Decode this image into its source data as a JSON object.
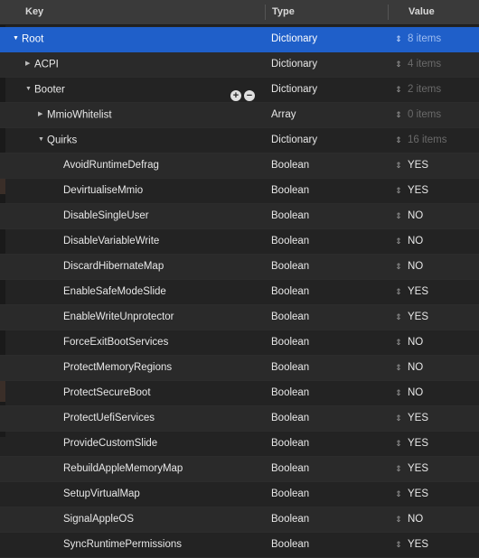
{
  "header": {
    "key": "Key",
    "type": "Type",
    "value": "Value"
  },
  "rows": [
    {
      "key": "Root",
      "type": "Dictionary",
      "value": "8 items",
      "disclosure": "open",
      "indent": 0,
      "value_dim": true
    },
    {
      "key": "ACPI",
      "type": "Dictionary",
      "value": "4 items",
      "disclosure": "closed",
      "indent": 1,
      "value_dim": true
    },
    {
      "key": "Booter",
      "type": "Dictionary",
      "value": "2 items",
      "disclosure": "open",
      "indent": 1,
      "value_dim": true,
      "has_add_remove": true
    },
    {
      "key": "MmioWhitelist",
      "type": "Array",
      "value": "0 items",
      "disclosure": "closed",
      "indent": 2,
      "value_dim": true
    },
    {
      "key": "Quirks",
      "type": "Dictionary",
      "value": "16 items",
      "disclosure": "open",
      "indent": 2,
      "value_dim": true
    },
    {
      "key": "AvoidRuntimeDefrag",
      "type": "Boolean",
      "value": "YES",
      "indent": 3
    },
    {
      "key": "DevirtualiseMmio",
      "type": "Boolean",
      "value": "YES",
      "indent": 3
    },
    {
      "key": "DisableSingleUser",
      "type": "Boolean",
      "value": "NO",
      "indent": 3
    },
    {
      "key": "DisableVariableWrite",
      "type": "Boolean",
      "value": "NO",
      "indent": 3
    },
    {
      "key": "DiscardHibernateMap",
      "type": "Boolean",
      "value": "NO",
      "indent": 3
    },
    {
      "key": "EnableSafeModeSlide",
      "type": "Boolean",
      "value": "YES",
      "indent": 3
    },
    {
      "key": "EnableWriteUnprotector",
      "type": "Boolean",
      "value": "YES",
      "indent": 3
    },
    {
      "key": "ForceExitBootServices",
      "type": "Boolean",
      "value": "NO",
      "indent": 3
    },
    {
      "key": "ProtectMemoryRegions",
      "type": "Boolean",
      "value": "NO",
      "indent": 3
    },
    {
      "key": "ProtectSecureBoot",
      "type": "Boolean",
      "value": "NO",
      "indent": 3
    },
    {
      "key": "ProtectUefiServices",
      "type": "Boolean",
      "value": "YES",
      "indent": 3
    },
    {
      "key": "ProvideCustomSlide",
      "type": "Boolean",
      "value": "YES",
      "indent": 3
    },
    {
      "key": "RebuildAppleMemoryMap",
      "type": "Boolean",
      "value": "YES",
      "indent": 3
    },
    {
      "key": "SetupVirtualMap",
      "type": "Boolean",
      "value": "YES",
      "indent": 3
    },
    {
      "key": "SignalAppleOS",
      "type": "Boolean",
      "value": "NO",
      "indent": 3
    },
    {
      "key": "SyncRuntimePermissions",
      "type": "Boolean",
      "value": "YES",
      "indent": 3
    }
  ],
  "icons": {
    "disclosure_open": "triangle-down-icon",
    "disclosure_closed": "triangle-right-icon",
    "stepper": "up-down-stepper-icon",
    "add": "add-circle-icon",
    "remove": "remove-circle-icon"
  },
  "colors": {
    "background": "#232323",
    "selection": "#1f5fc9",
    "header": "#3a3a3a"
  }
}
